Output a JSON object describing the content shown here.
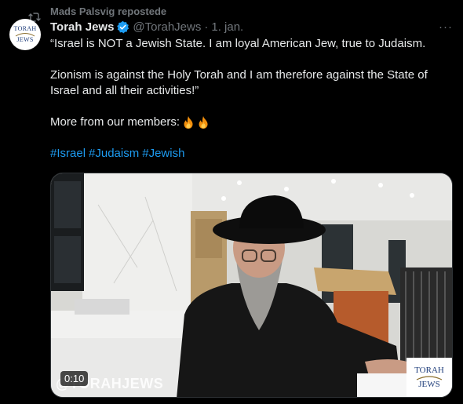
{
  "repost": {
    "label": "Mads Palsvig repostede",
    "icon": "repost-icon"
  },
  "author": {
    "display_name": "Torah Jews",
    "handle": "@TorahJews",
    "separator": "·",
    "date": "1. jan.",
    "verified": true,
    "avatar_logo_lines": [
      "TORAH",
      "JEWS"
    ]
  },
  "more_label": "···",
  "tweet": {
    "line1": "“Israel is NOT a Jewish State. I am  loyal American Jew, true to Judaism.",
    "line2": "Zionism is against the Holy Torah and I am therefore against the State of Israel and all their activities!”",
    "line3": "More from our members: ",
    "hashtags": [
      "#Israel",
      "#Judaism",
      "#Jewish"
    ]
  },
  "media": {
    "timer": "0:10",
    "watermark": "@TORAHJEWS",
    "corner_logo": [
      "TORAH",
      "JEWS"
    ]
  },
  "colors": {
    "background": "#000000",
    "text": "#e7e9ea",
    "muted": "#71767b",
    "link": "#1d9bf0",
    "verified": "#1d9bf0"
  }
}
